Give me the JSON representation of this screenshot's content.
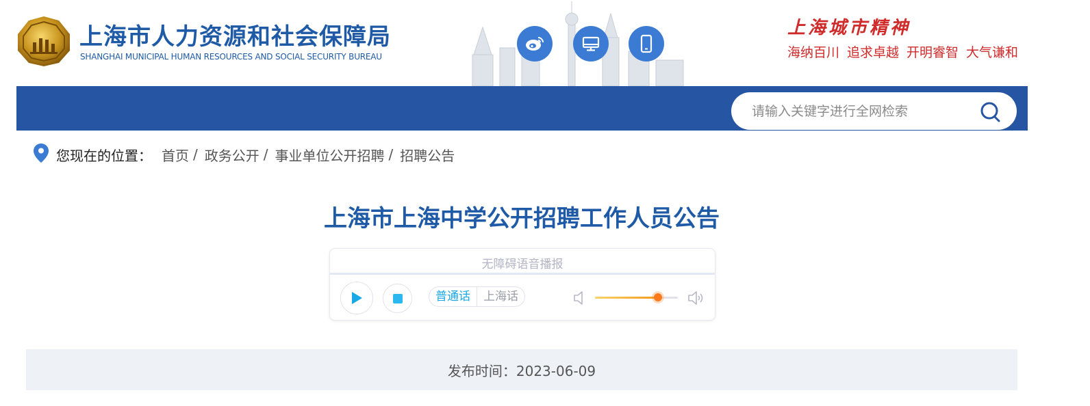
{
  "header": {
    "title": "上海市人力资源和社会保障局",
    "subtitle": "SHANGHAI MUNICIPAL HUMAN RESOURCES AND SOCIAL SECURITY BUREAU",
    "emblem_icon": "bureau-emblem-icon",
    "icons": [
      "weibo-icon",
      "desktop-icon",
      "mobile-icon"
    ],
    "spirit_title": "上海城市精神",
    "spirit_slogans": [
      "海纳百川",
      "追求卓越",
      "开明睿智",
      "大气谦和"
    ]
  },
  "nav": {
    "search_placeholder": "请输入关键字进行全网检索",
    "search_icon": "search-icon"
  },
  "breadcrumb": {
    "label": "您现在的位置：",
    "items": [
      "首页",
      "政务公开",
      "事业单位公开招聘",
      "招聘公告"
    ],
    "separator": "/"
  },
  "article": {
    "title": "上海市上海中学公开招聘工作人员公告"
  },
  "audio": {
    "title": "无障碍语音播报",
    "languages": [
      "普通话",
      "上海话"
    ],
    "selected_language": "普通话",
    "progress": 0,
    "volume": 0.76
  },
  "publish": {
    "label": "发布时间：",
    "date": "2023-06-09"
  },
  "colors": {
    "brand_blue": "#2655a3",
    "title_blue": "#1f5aa6",
    "spirit_red": "#d02b2b",
    "audio_accent": "#19a8e6",
    "volume_knob": "#ff7a1a"
  }
}
